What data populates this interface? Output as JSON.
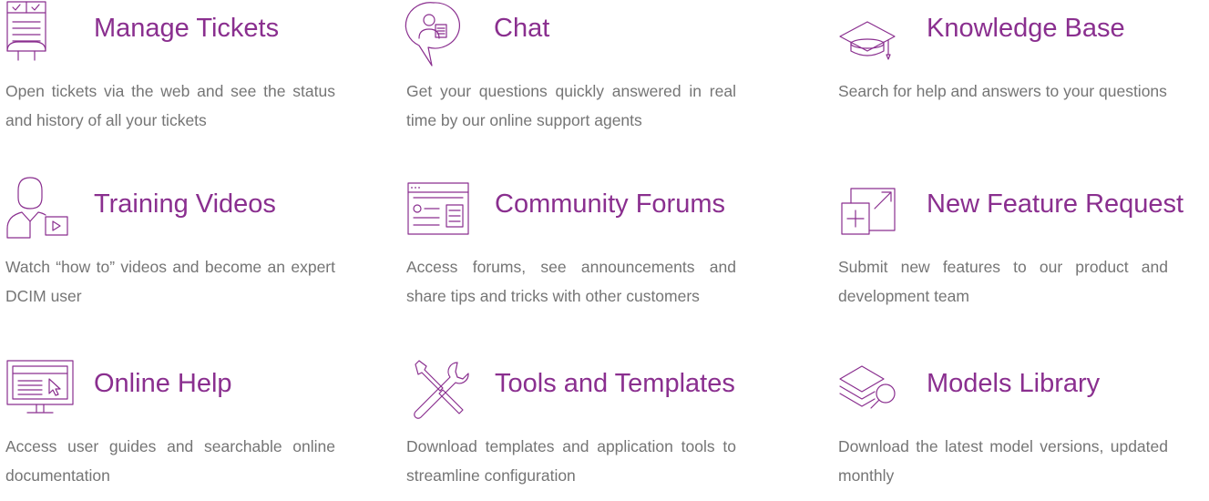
{
  "features": [
    {
      "title": "Manage Tickets",
      "description": "Open tickets via the web and see the status and history of all your tickets",
      "icon": "ticket-checklist-icon"
    },
    {
      "title": "Chat",
      "description": "Get your questions quickly answered in real time by our online support agents",
      "icon": "chat-agent-icon"
    },
    {
      "title": "Knowledge Base",
      "description": "Search for help and answers to your questions",
      "icon": "graduation-cap-icon"
    },
    {
      "title": "Training Videos",
      "description": "Watch “how to” videos and become an expert DCIM user",
      "icon": "trainer-video-icon"
    },
    {
      "title": "Community Forums",
      "description": "Access forums, see announcements and share tips and tricks with other customers",
      "icon": "forum-window-icon"
    },
    {
      "title": "New Feature Request",
      "description": "Submit new features to our product and development team",
      "icon": "new-feature-icon"
    },
    {
      "title": "Online Help",
      "description": "Access user guides and searchable online documentation",
      "icon": "monitor-help-icon"
    },
    {
      "title": "Tools and Templates",
      "description": "Download templates and application tools to streamline configuration",
      "icon": "wrench-screwdriver-icon"
    },
    {
      "title": "Models Library",
      "description": "Download the latest model versions, updated monthly",
      "icon": "layers-search-icon"
    }
  ],
  "accent_color": "#8a2f8f",
  "text_color": "#757575"
}
